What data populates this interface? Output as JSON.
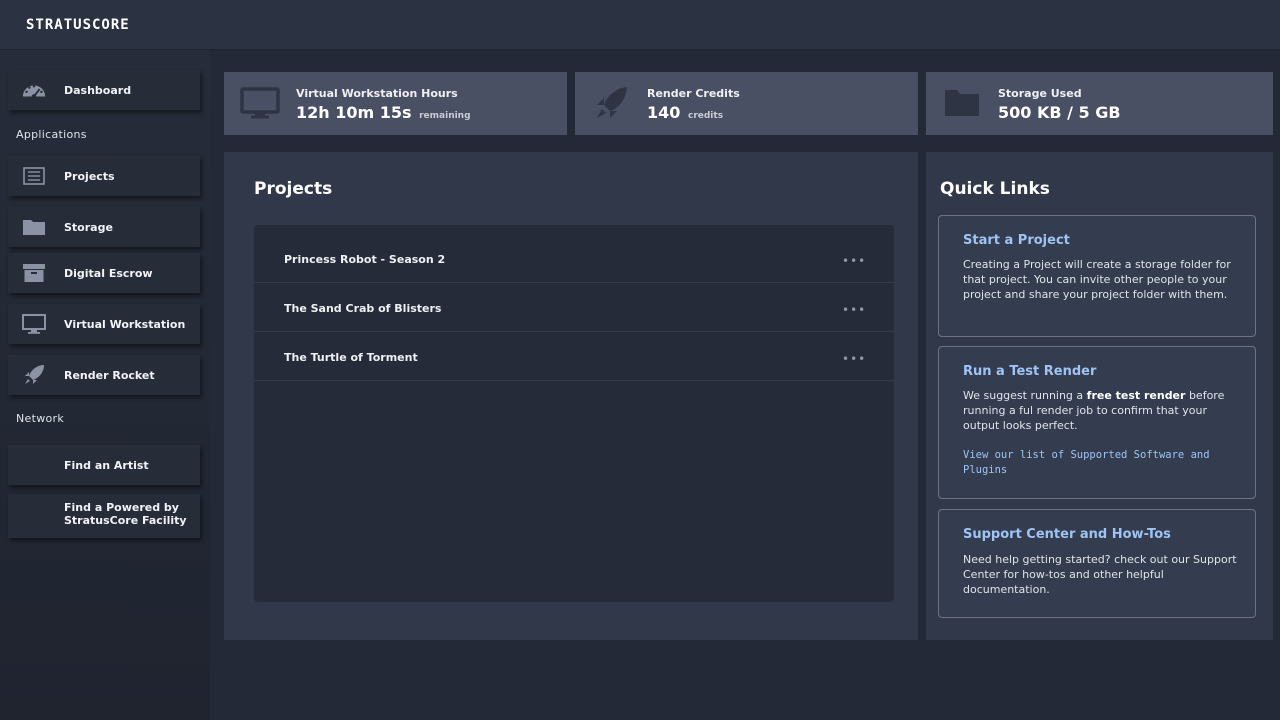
{
  "app": {
    "logo": "STRATUSCORE"
  },
  "sidebar": {
    "dashboard": {
      "label": "Dashboard",
      "icon": "speedometer-icon"
    },
    "sections": {
      "applications": "Applications",
      "network": "Network"
    },
    "applications": [
      {
        "label": "Projects",
        "icon": "list-icon"
      },
      {
        "label": "Storage",
        "icon": "folder-icon"
      },
      {
        "label": "Digital Escrow",
        "icon": "archive-box-icon"
      },
      {
        "label": "Virtual Workstation",
        "icon": "monitor-icon"
      },
      {
        "label": "Render Rocket",
        "icon": "rocket-icon"
      }
    ],
    "network": [
      {
        "label": "Find an Artist"
      },
      {
        "label_line1": "Find a Powered by",
        "label_line2": "StratusCore Facility"
      }
    ]
  },
  "stats": [
    {
      "title": "Virtual Workstation Hours",
      "value": "12h 10m 15s",
      "unit": "remaining",
      "icon": "monitor-icon"
    },
    {
      "title": "Render Credits",
      "value": "140",
      "unit": "credits",
      "icon": "rocket-icon"
    },
    {
      "title": "Storage Used",
      "value": "500 KB / 5 GB",
      "unit": "",
      "icon": "folder-icon"
    }
  ],
  "projects": {
    "title": "Projects",
    "items": [
      {
        "name": "Princess Robot - Season 2",
        "more": "•••"
      },
      {
        "name": "The Sand Crab of Blisters",
        "more": "•••"
      },
      {
        "name": "The Turtle of Torment",
        "more": "•••"
      }
    ]
  },
  "quick_links": {
    "title": "Quick Links",
    "cards": [
      {
        "title": "Start a Project",
        "text": "Creating a Project will create a storage folder for that project. You can invite other people to your project and share your project folder with them."
      },
      {
        "title": "Run a Test Render",
        "text_before": "We suggest running a ",
        "text_bold": "free test render",
        "text_after": " before running a ful render job to confirm that your output looks perfect.",
        "link": "View our list of Supported Software and Plugins"
      },
      {
        "title": "Support Center and How-Tos",
        "text": "Need help getting started? check out our Support Center for how-tos and other helpful documentation."
      }
    ]
  },
  "colors": {
    "background": "#232936",
    "topbar": "#2b3241",
    "stat_card": "#495063",
    "panel": "#30384a",
    "link": "#9fc3f2"
  }
}
